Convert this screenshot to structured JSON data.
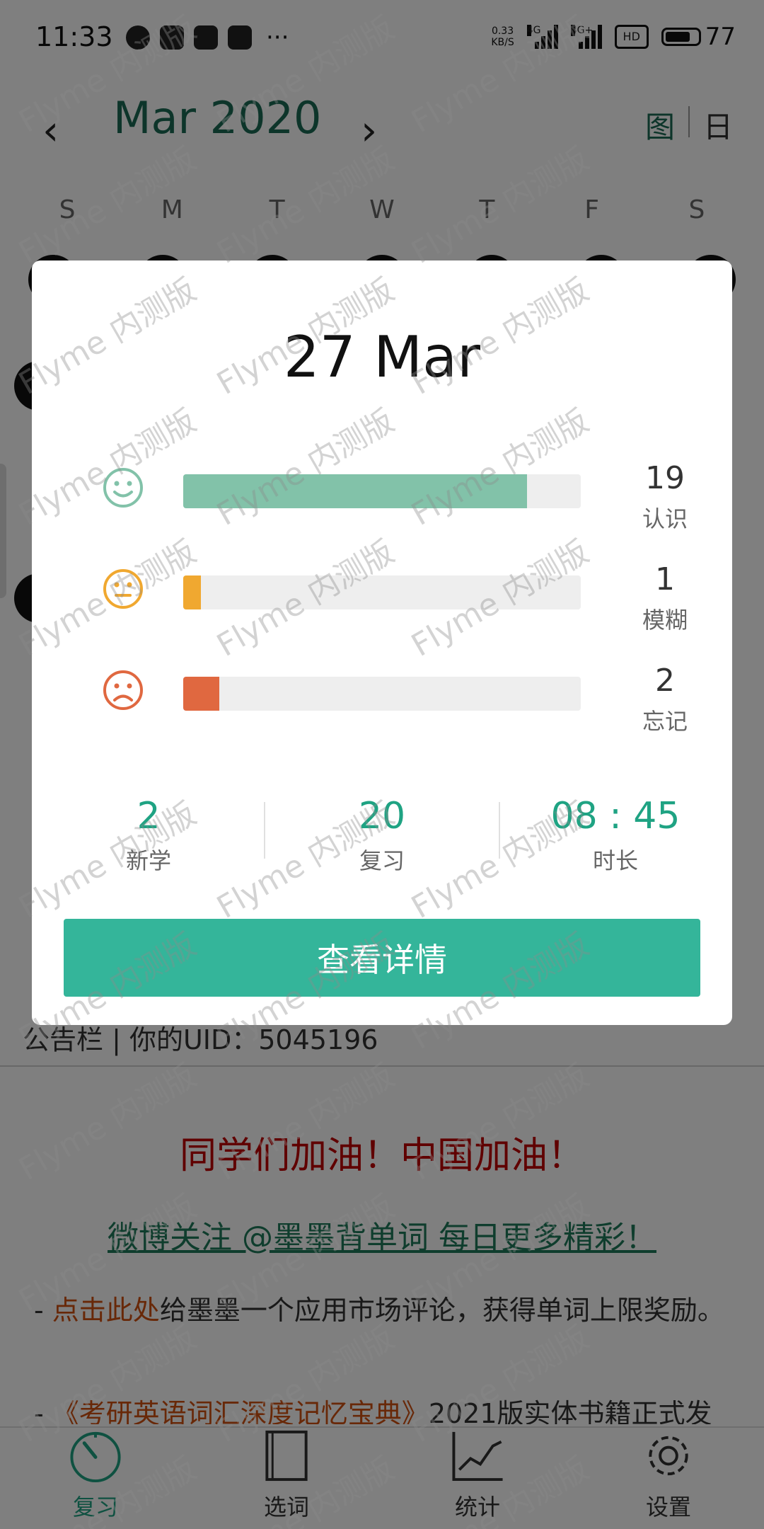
{
  "status_bar": {
    "time": "11:33",
    "net_speed_value": "0.33",
    "net_speed_unit": "KB/S",
    "sim1": "4G",
    "sim2": "4G+",
    "hd": "HD",
    "battery": "77"
  },
  "calendar": {
    "prev_icon": "chevron-left-icon",
    "next_icon": "chevron-right-icon",
    "month_title": "Mar 2020",
    "view_chart": "图",
    "view_day": "日",
    "weekdays": [
      "S",
      "M",
      "T",
      "W",
      "T",
      "F",
      "S"
    ]
  },
  "board": {
    "header": "公告栏 | 你的UID：5045196",
    "slogan": "同学们加油！中国加油！",
    "weibo": "微博关注 @墨墨背单词 每日更多精彩！",
    "para1_link": "点击此处",
    "para1_text": "给墨墨一个应用市场评论，获得单词上限奖励。",
    "para2_link": "《考研英语词汇深度记忆宝典》",
    "para2_text": "2021版实体书籍正式发"
  },
  "bottom_nav": [
    {
      "label": "复习",
      "icon": "timer-icon",
      "active": true
    },
    {
      "label": "选词",
      "icon": "book-icon",
      "active": false
    },
    {
      "label": "统计",
      "icon": "chart-icon",
      "active": false
    },
    {
      "label": "设置",
      "icon": "gear-icon",
      "active": false
    }
  ],
  "dialog": {
    "date": "27 Mar",
    "rows": [
      {
        "icon": "smile-face-icon",
        "count": "19",
        "label": "认识",
        "ratio": 0.864,
        "color": "#82c2a9"
      },
      {
        "icon": "neutral-face-icon",
        "count": "1",
        "label": "模糊",
        "ratio": 0.045,
        "color": "#f0a830"
      },
      {
        "icon": "sad-face-icon",
        "count": "2",
        "label": "忘记",
        "ratio": 0.091,
        "color": "#e06840"
      }
    ],
    "summary": [
      {
        "value": "2",
        "label": "新学"
      },
      {
        "value": "20",
        "label": "复习"
      },
      {
        "value": "08 : 45",
        "label": "时长"
      }
    ],
    "button": "查看详情"
  },
  "watermark": "Flyme 内测版",
  "colors": {
    "accent": "#34b59a",
    "title_green": "#1a6a55",
    "slogan_red": "#c00000",
    "link_orange": "#d05010"
  }
}
